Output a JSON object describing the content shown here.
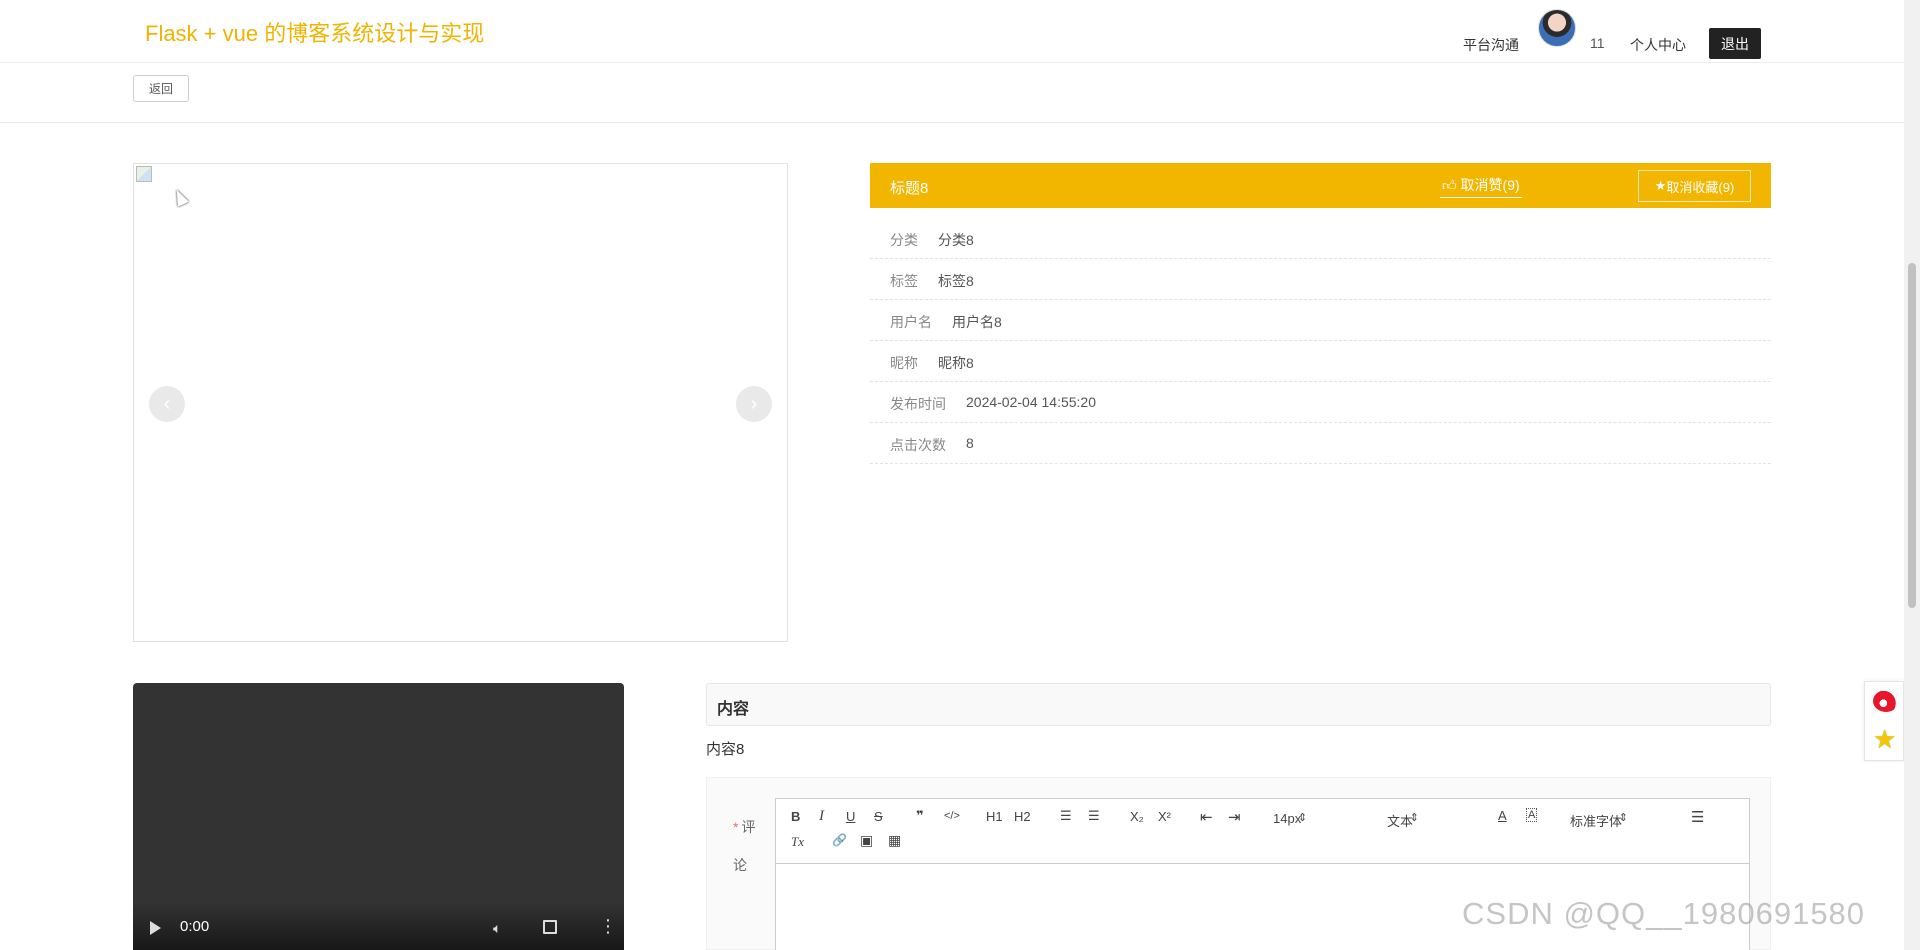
{
  "header": {
    "site_title": "Flask + vue 的博客系统设计与实现",
    "nav_chat": "平台沟通",
    "user_count": "11",
    "nav_center": "个人中心",
    "logout_label": "退出"
  },
  "subbar": {
    "back_label": "返回"
  },
  "info": {
    "title": "标题8",
    "like_label": "取消赞(9)",
    "fav_label": "取消收藏(9)",
    "rows": [
      {
        "label": "分类",
        "value": "分类8"
      },
      {
        "label": "标签",
        "value": "标签8"
      },
      {
        "label": "用户名",
        "value": "用户名8"
      },
      {
        "label": "昵称",
        "value": "昵称8"
      },
      {
        "label": "发布时间",
        "value": "2024-02-04 14:55:20"
      },
      {
        "label": "点击次数",
        "value": "8"
      }
    ]
  },
  "carousel": {
    "prev": "‹",
    "next": "›"
  },
  "video": {
    "time": "0:00"
  },
  "content": {
    "header": "内容",
    "text": "内容8"
  },
  "comment": {
    "required": "*",
    "label": "评论",
    "toolbar": {
      "bold": "B",
      "italic": "I",
      "underline": "U",
      "strike": "S",
      "quote": "❞",
      "code": "</>",
      "h1": "H1",
      "h2": "H2",
      "ordered": "☰",
      "bullet": "☰",
      "sub": "X₂",
      "sup": "X²",
      "outdent": "⇤",
      "indent": "⇥",
      "size": "14px",
      "header": "文本",
      "font": "标准字体",
      "clean": "Tx",
      "link": "🔗",
      "image": "▣",
      "video": "▦"
    }
  },
  "watermark": "CSDN @QQ__1980691580",
  "colors": {
    "accent": "#f3b600",
    "title": "#f0b400",
    "dark": "#222222"
  }
}
